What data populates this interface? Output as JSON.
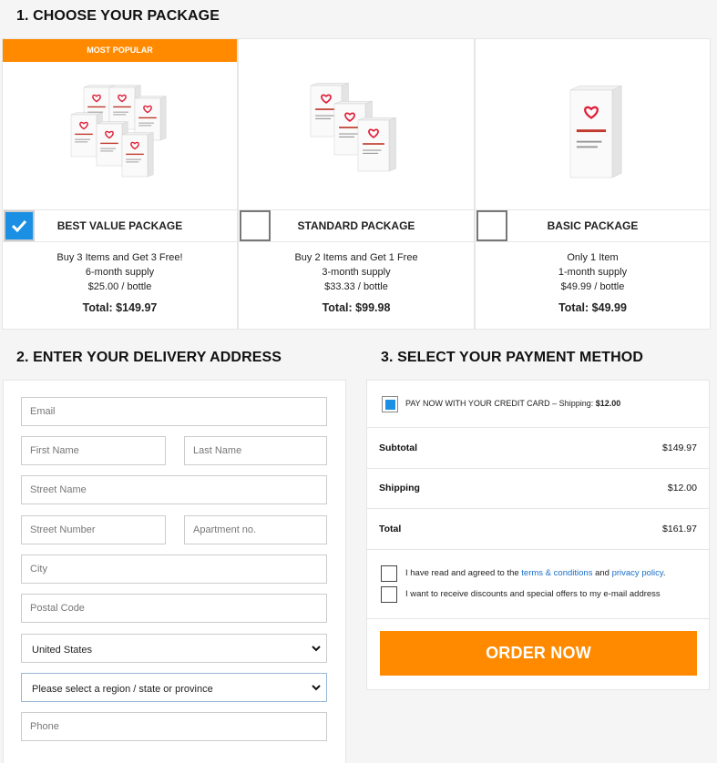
{
  "sections": {
    "package_title": "1. CHOOSE YOUR PACKAGE",
    "delivery_title": "2. ENTER YOUR DELIVERY ADDRESS",
    "payment_title": "3. SELECT YOUR PAYMENT METHOD"
  },
  "packages": [
    {
      "ribbon": "MOST POPULAR",
      "name": "BEST VALUE PACKAGE",
      "line1": "Buy 3 Items and Get 3 Free!",
      "line2": "6-month supply",
      "line3": "$25.00 / bottle",
      "total": "Total: $149.97",
      "selected": true,
      "bottles": 6
    },
    {
      "ribbon": "",
      "name": "STANDARD PACKAGE",
      "line1": "Buy 2 Items and Get 1 Free",
      "line2": "3-month supply",
      "line3": "$33.33 / bottle",
      "total": "Total: $99.98",
      "selected": false,
      "bottles": 3
    },
    {
      "ribbon": "",
      "name": "BASIC PACKAGE",
      "line1": "Only 1 Item",
      "line2": "1-month supply",
      "line3": "$49.99 / bottle",
      "total": "Total: $49.99",
      "selected": false,
      "bottles": 1
    }
  ],
  "product_label": "Lipid Control Plus",
  "address_form": {
    "email_placeholder": "Email",
    "first_name_placeholder": "First Name",
    "last_name_placeholder": "Last Name",
    "street_name_placeholder": "Street Name",
    "street_number_placeholder": "Street Number",
    "apartment_placeholder": "Apartment no.",
    "city_placeholder": "City",
    "postal_code_placeholder": "Postal Code",
    "country_selected": "United States",
    "region_selected": "Please select a region / state or province",
    "phone_placeholder": "Phone"
  },
  "payment": {
    "method_label": "PAY NOW WITH YOUR CREDIT CARD – Shipping:",
    "method_shipping": "$12.00",
    "subtotal_label": "Subtotal",
    "subtotal_value": "$149.97",
    "shipping_label": "Shipping",
    "shipping_value": "$12.00",
    "total_label": "Total",
    "total_value": "$161.97",
    "terms_prefix": "I have read and agreed to the",
    "terms_link": "terms & conditions",
    "terms_and": "and",
    "privacy_link": "privacy policy",
    "terms_suffix": ".",
    "offers_text": "I want to receive discounts and special offers to my e-mail address",
    "order_button": "ORDER NOW"
  },
  "colors": {
    "accent": "#ff8a00",
    "selected": "#1a8fe3",
    "link": "#1a6fc9"
  },
  "icons": {
    "selected_check": "checkmark-icon",
    "dropdown": "chevron-down-icon"
  }
}
